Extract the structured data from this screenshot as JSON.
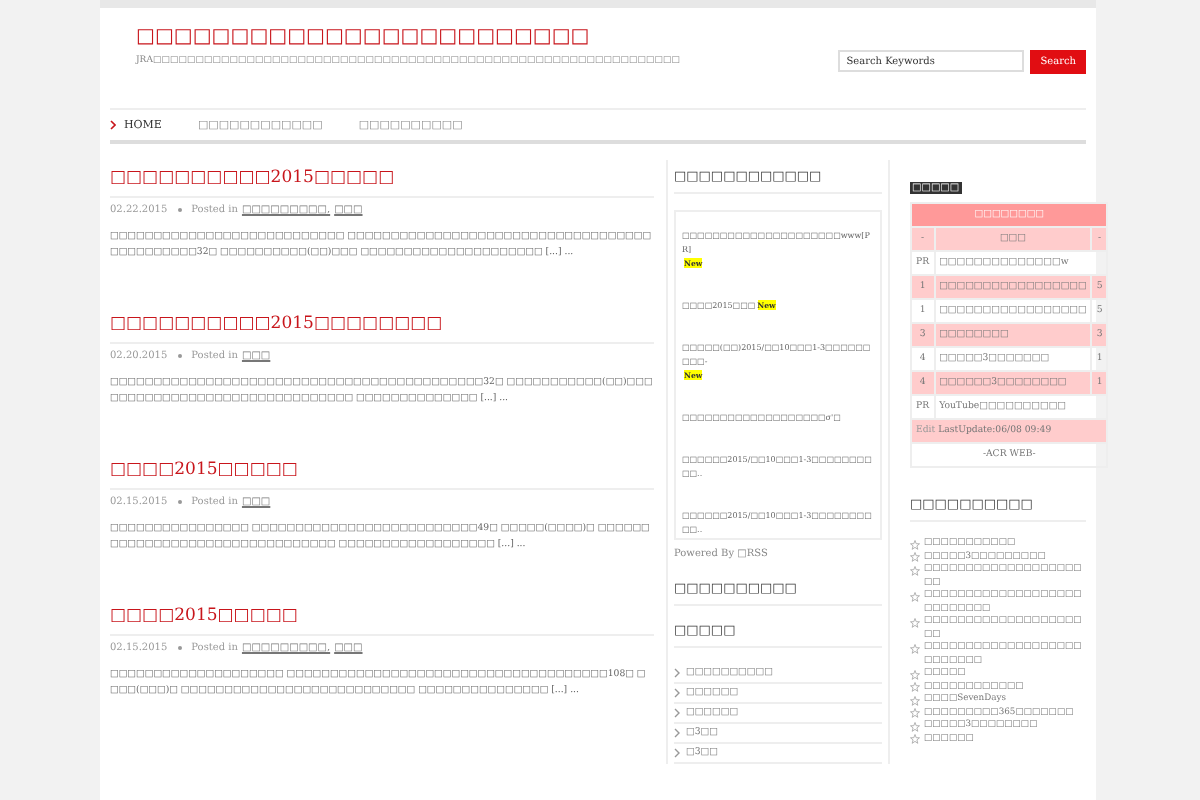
{
  "header": {
    "title": "□□□□□□□□□□□□□□□□□□□□□□□□",
    "tagline": "JRA□□□□□□□□□□□□□□□□□□□□□□□□□□□□□□□□□□□□□□□□□□□□□□□□□□□□□□□□□□□□□□",
    "search": {
      "placeholder": "Search Keywords",
      "button": "Search"
    }
  },
  "nav": [
    {
      "label": "HOME",
      "selected": true
    },
    {
      "label": "□□□□□□□□□□□□",
      "selected": false
    },
    {
      "label": "□□□□□□□□□□",
      "selected": false
    }
  ],
  "posts": [
    {
      "title": "□□□□□□□□□□2015□□□□□",
      "date": "02.22.2015",
      "posted_in": "Posted in",
      "categories": [
        "□□□□□□□□□,",
        "□□□"
      ],
      "excerpt": "□□□□□□□□□□□□□□□□□□□□□□□□□□□ □□□□□□□□□□□□□□□□□□□□□□□□□□□□□□□□□□□□□□□□□□□□□32□ □□□□□□□□□□(□□)□□□ □□□□□□□□□□□□□□□□□□□□□ [...] ..."
    },
    {
      "title": "□□□□□□□□□□2015□□□□□□□□",
      "date": "02.20.2015",
      "posted_in": "Posted in",
      "categories": [
        "□□□"
      ],
      "excerpt": "□□□□□□□□□□□□□□□□□□□□□□□□□□□□□□□□□□□□□□□□□□□32□ □□□□□□□□□□□(□□)□□□ □□□□□□□□□□□□□□□□□□□□□□□□□□□□ □□□□□□□□□□□□□□ [...] ..."
    },
    {
      "title": "□□□□2015□□□□□",
      "date": "02.15.2015",
      "posted_in": "Posted in",
      "categories": [
        "□□□"
      ],
      "excerpt": "□□□□□□□□□□□□□□□□ □□□□□□□□□□□□□□□□□□□□□□□□□□49□ □□□□□(□□□□)□ □□□□□□□□□□□□□□□□□□□□□□□□□□□□□□□□ □□□□□□□□□□□□□□□□□□ [...] ..."
    },
    {
      "title": "□□□□2015□□□□□",
      "date": "02.15.2015",
      "posted_in": "Posted in",
      "categories": [
        "□□□□□□□□□,",
        "□□□"
      ],
      "excerpt": "□□□□□□□□□□□□□□□□□□□□ □□□□□□□□□□□□□□□□□□□□□□□□□□□□□□□□□□□□□108□ □□□□(□□□)□ □□□□□□□□□□□□□□□□□□□□□□□□□□□ □□□□□□□□□□□□□□□ [...] ..."
    }
  ],
  "sidebar": {
    "feed_title": "□□□□□□□□□□□□",
    "feed_items": [
      {
        "text": "□□□□□□□□□□□□□□□□□□□□□www[PR]",
        "new_badge": "New"
      },
      {
        "text": "□□□□2015□□□",
        "new_badge": "New"
      },
      {
        "text": "□□□□□(□□)2015/□□10□□□1-3□□□□□□□□□-",
        "new_badge": "New"
      },
      {
        "text": "□□□□□□□□□□□□□□□□□□□σ'□"
      },
      {
        "text": "□□□□□□2015/□□10□□□1-3□□□□□□□□□□.."
      },
      {
        "text": "□□□□□□2015/□□10□□□1-3□□□□□□□□□□.."
      }
    ],
    "powered": "Powered By □RSS",
    "heading_2": "□□□□□□□□□□",
    "categories_title": "□□□□□",
    "categories": [
      "□□□□□□□□□□",
      "□□□□□□",
      "□□□□□□",
      "□3□□",
      "□3□□"
    ]
  },
  "ranking": {
    "label": "□□□□□",
    "title": "□□□□□□□□",
    "columns": [
      "-",
      "□□□",
      "-"
    ],
    "rows": [
      {
        "rank": "PR",
        "title": "□□□□□□□□□□□□□□w"
      },
      {
        "rank": "1",
        "title": "□□□□□□□□□□□□□□□□□",
        "count": "5"
      },
      {
        "rank": "1",
        "title": "□□□□□□□□□□□□□□□□□",
        "count": "5"
      },
      {
        "rank": "3",
        "title": "□□□□□□□□",
        "count": "3"
      },
      {
        "rank": "4",
        "title": "□□□□□3□□□□□□□",
        "count": "1"
      },
      {
        "rank": "4",
        "title": "□□□□□□3□□□□□□□□",
        "count": "1"
      },
      {
        "rank": "PR",
        "title": "YouTube□□□□□□□□□□"
      }
    ],
    "edit": "Edit",
    "update": "LastUpdate:06/08 09:49",
    "credit": "-ACR WEB-"
  },
  "links": {
    "title": "□□□□□□□□□□",
    "items": [
      "□□□□□□□□□□□",
      "□□□□□3□□□□□□□□□",
      "□□□□□□□□□□□□□□□□□□□□□",
      "□□□□□□□□□□□□□□□□□□□□□□□□□□□",
      "□□□□□□□□□□□□□□□□□□□□□",
      "□□□□□□□□□□□□□□□□□□□□□□□□□□",
      "□□□□□",
      "□□□□□□□□□□□□",
      "□□□□SevenDays",
      "□□□□□□□□□365□□□□□□□",
      "□□□□□3□□□□□□□□",
      "□□□□□□"
    ]
  }
}
